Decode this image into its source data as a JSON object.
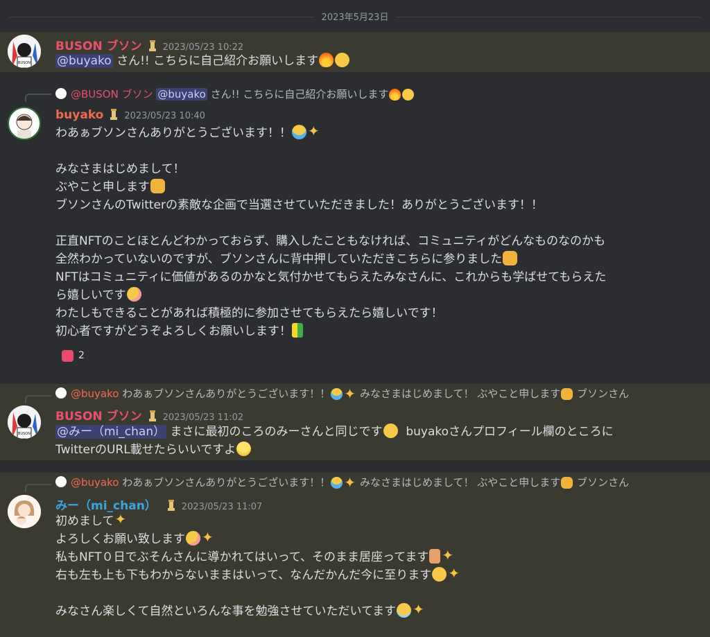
{
  "date_divider": "2023年5月23日",
  "colors": {
    "buson": "#e8516c",
    "buyako": "#ef6b4e",
    "michan": "#3aa6e0",
    "highlight_bg": "#3b3a30",
    "bg": "#2b2d31",
    "mention_bg": "#3c4270"
  },
  "messages": [
    {
      "author": "BUSON ブソン",
      "timestamp": "2023/05/23 10:22",
      "bot_icon": "chess-piece-icon",
      "mention": "@buyako",
      "text": " さん!! こちらに自己紹介お願いします"
    },
    {
      "reply_author": "@BUSON ブソン",
      "reply_mention": "@buyako",
      "reply_text": " さん!! こちらに自己紹介お願いします",
      "author": "buyako",
      "timestamp": "2023/05/23 10:40",
      "lines": [
        "わあぁブソンさんありがとうございます！！",
        "",
        "みなさまはじめまして！",
        "ぶやこと申します",
        "ブソンさんのTwitterの素敵な企画で当選させていただきました！ありがとうございます！！",
        "",
        "正直NFTのことほとんどわかっておらず、購入したこともなければ、コミュニティがどんなものなのかも",
        "全然わかっていないのですが、ブソンさんに背中押していただきこちらに参りました",
        "NFTはコミュニティに価値があるのかなと気付かせてもらえたみなさんに、これからも学ばせてもらえた",
        "ら嬉しいです",
        "わたしもできることがあれば積極的に参加させてもらえたら嬉しいです！",
        "初心者ですがどうぞよろしくお願いします！"
      ],
      "reaction_count": "2"
    },
    {
      "reply_author": "@buyako",
      "reply_text": " わあぁブソンさんありがとうございます！！",
      "reply_text2": " みなさまはじめまして！ ぶやこと申します",
      "reply_text3": " ブソンさん",
      "author": "BUSON ブソン",
      "timestamp": "2023/05/23 11:02",
      "mention": "@みー（mi_chan）",
      "text1": " まさに最初のころのみーさんと同じです",
      "text2": "  buyakoさんプロフィール欄のところに",
      "text3": "TwitterのURL載せたらいいですよ"
    },
    {
      "reply_author": "@buyako",
      "reply_text": " わあぁブソンさんありがとうございます！！",
      "reply_text2": " みなさまはじめまして！ ぶやこと申します",
      "reply_text3": " ブソンさん",
      "author": "みー（mi_chan）",
      "timestamp": "2023/05/23 11:07",
      "lines": [
        "初めまして",
        "よろしくお願い致します",
        "私もNFT０日でぶそんさんに導かれてはいって、そのまま居座ってます",
        "右も左も上も下もわからないままはいって、なんだかんだ今に至ります",
        "",
        "みなさん楽しくて自然といろんな事を勉強させていただいてます"
      ]
    }
  ]
}
